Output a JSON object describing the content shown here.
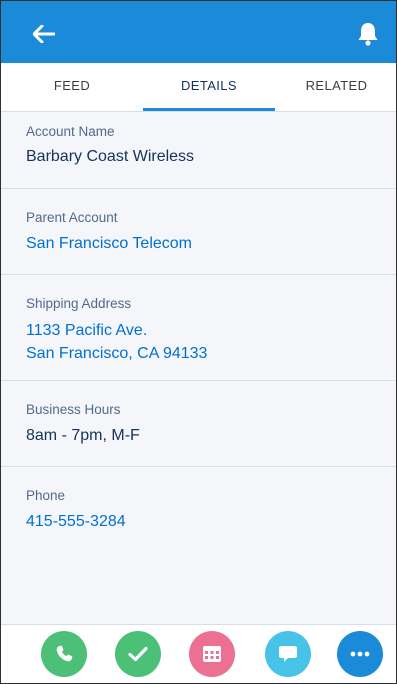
{
  "header": {
    "back_icon": "arrow-left-icon",
    "notification_icon": "bell-icon",
    "bar_color": "#1b8ad8"
  },
  "tabs": [
    {
      "label": "FEED",
      "active": false
    },
    {
      "label": "DETAILS",
      "active": true
    },
    {
      "label": "RELATED",
      "active": false
    }
  ],
  "details": {
    "account_name": {
      "label": "Account Name",
      "value": "Barbary Coast Wireless"
    },
    "parent_account": {
      "label": "Parent Account",
      "value": "San Francisco Telecom"
    },
    "shipping_address": {
      "label": "Shipping Address",
      "line1": "1133 Pacific Ave.",
      "line2": "San Francisco, CA 94133"
    },
    "business_hours": {
      "label": "Business Hours",
      "value": "8am - 7pm, M-F"
    },
    "phone": {
      "label": "Phone",
      "value": "415-555-3284"
    }
  },
  "actions": [
    {
      "icon": "phone-icon",
      "color": "#4bc076"
    },
    {
      "icon": "checkmark-icon",
      "color": "#4bc076"
    },
    {
      "icon": "calendar-icon",
      "color": "#eb7092"
    },
    {
      "icon": "chat-bubble-icon",
      "color": "#48c3e8"
    },
    {
      "icon": "more-icon",
      "color": "#1b8ad8"
    }
  ]
}
